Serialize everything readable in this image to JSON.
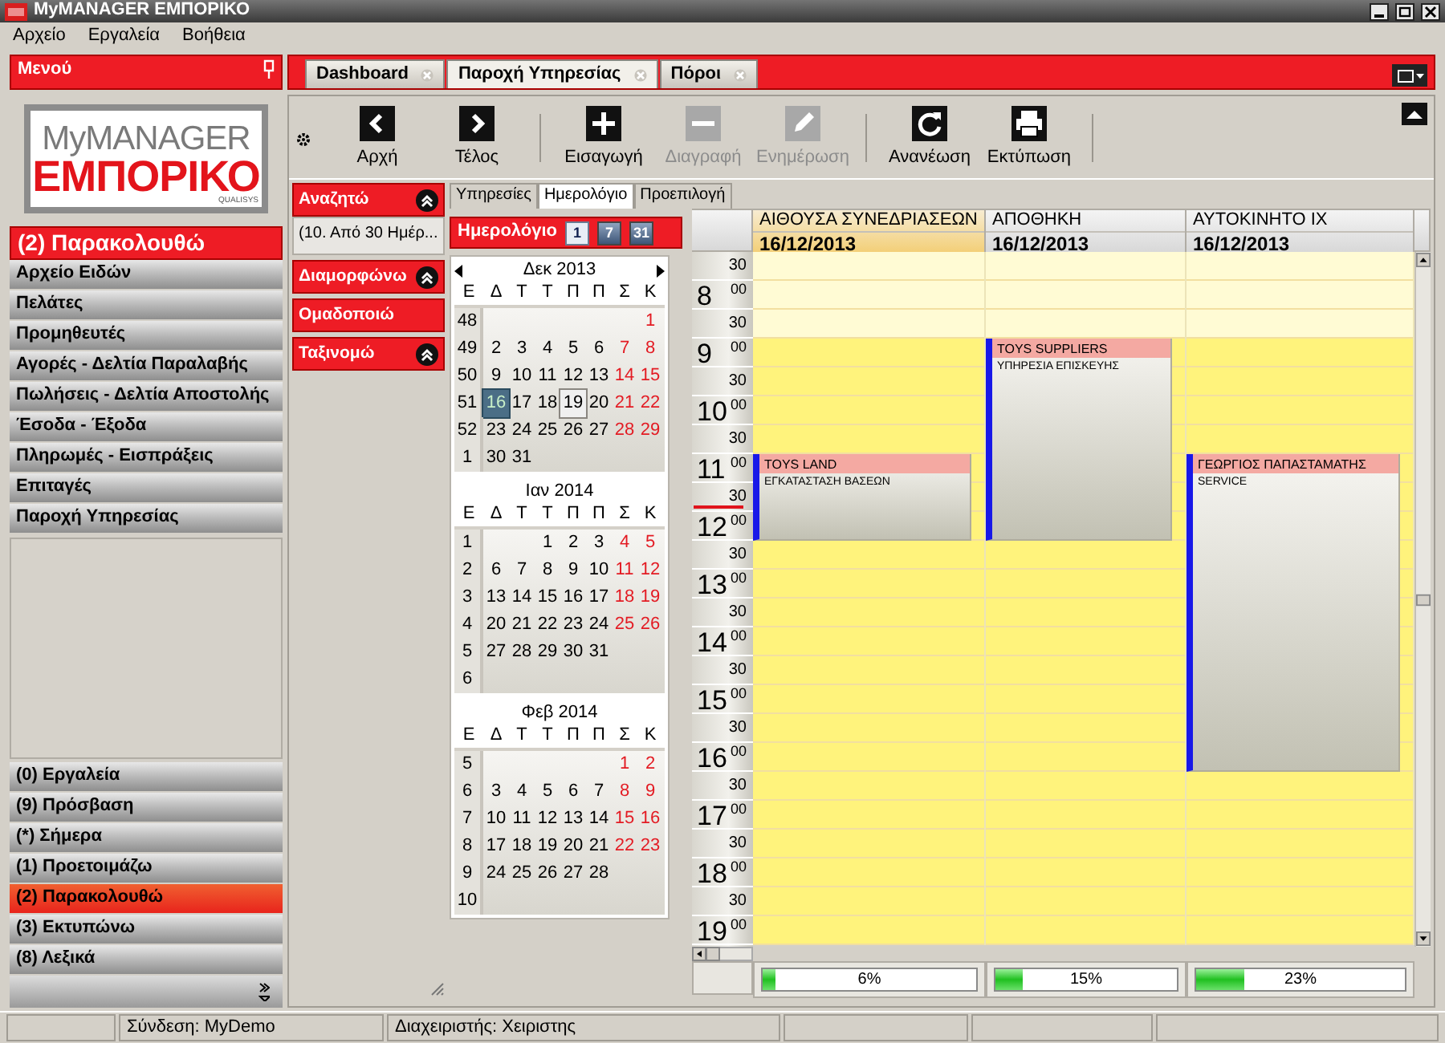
{
  "window": {
    "title": "MyMANAGER ΕΜΠΟΡΙΚΟ"
  },
  "menu_bar": [
    "Αρχείο",
    "Εργαλεία",
    "Βοήθεια"
  ],
  "sidebar": {
    "title": "Μενού",
    "logo": {
      "line1": "MyMANAGER",
      "line2": "ΕΜΠΟΡΙΚΟ",
      "line3": "QUALISYS"
    },
    "section": "(2) Παρακολουθώ",
    "items": [
      "Αρχείο Ειδών",
      "Πελάτες",
      "Προμηθευτές",
      "Αγορές - Δελτία Παραλαβής",
      "Πωλήσεις - Δελτία Αποστολής",
      "Έσοδα - Έξοδα",
      "Πληρωμές - Εισπράξεις",
      "Επιταγές",
      "Παροχή Υπηρεσίας"
    ],
    "groups": [
      {
        "label": "(0) Εργαλεία",
        "selected": false
      },
      {
        "label": "(9) Πρόσβαση",
        "selected": false
      },
      {
        "label": "(*) Σήμερα",
        "selected": false
      },
      {
        "label": "(1) Προετοιμάζω",
        "selected": false
      },
      {
        "label": "(2) Παρακολουθώ",
        "selected": true
      },
      {
        "label": "(3) Εκτυπώνω",
        "selected": false
      },
      {
        "label": "(8) Λεξικά",
        "selected": false
      }
    ]
  },
  "tabs": [
    {
      "label": "Dashboard",
      "selected": false
    },
    {
      "label": "Παροχή Υπηρεσίας",
      "selected": true
    },
    {
      "label": "Πόροι",
      "selected": false
    }
  ],
  "toolbar": [
    {
      "kind": "first",
      "label": "Αρχή",
      "disabled": false
    },
    {
      "kind": "last",
      "label": "Τέλος",
      "disabled": false
    },
    {
      "kind": "insert",
      "label": "Εισαγωγή",
      "disabled": false
    },
    {
      "kind": "delete",
      "label": "Διαγραφή",
      "disabled": true
    },
    {
      "kind": "edit",
      "label": "Ενημέρωση",
      "disabled": true
    },
    {
      "kind": "refresh",
      "label": "Ανανέωση",
      "disabled": false
    },
    {
      "kind": "print",
      "label": "Εκτύπωση",
      "disabled": false
    }
  ],
  "filters": [
    {
      "label": "Αναζητώ",
      "collapsible": true,
      "value": "(10. Από 30 Ημέρ..."
    },
    {
      "label": "Διαμορφώνω",
      "collapsible": true
    },
    {
      "label": "Ομαδοποιώ",
      "collapsible": false
    },
    {
      "label": "Ταξινομώ",
      "collapsible": true
    }
  ],
  "view_tabs": [
    {
      "label": "Υπηρεσίες",
      "selected": false
    },
    {
      "label": "Ημερολόγιο",
      "selected": true
    },
    {
      "label": "Προεπιλογή",
      "selected": false
    }
  ],
  "calendar": {
    "title": "Ημερολόγιο",
    "views": [
      {
        "label": "1",
        "selected": true
      },
      {
        "label": "7",
        "selected": false
      },
      {
        "label": "31",
        "selected": false
      }
    ],
    "months": [
      {
        "title": "Δεκ 2013",
        "arrows": true,
        "weekdays": [
          "Ε",
          "Δ",
          "Τ",
          "Τ",
          "Π",
          "Π",
          "Σ",
          "Κ"
        ],
        "weeks": [
          {
            "week": "48",
            "align_end": true,
            "days": [
              "1"
            ]
          },
          {
            "week": "49",
            "days": [
              "2",
              "3",
              "4",
              "5",
              "6",
              "7",
              "8"
            ]
          },
          {
            "week": "50",
            "days": [
              "9",
              "10",
              "11",
              "12",
              "13",
              "14",
              "15"
            ]
          },
          {
            "week": "51",
            "days": [
              {
                "t": "16",
                "selected": true,
                "today": false
              },
              "17",
              "18",
              {
                "t": "19",
                "selected": false,
                "today": true
              },
              "20",
              "21",
              "22"
            ]
          },
          {
            "week": "52",
            "days": [
              "23",
              "24",
              "25",
              "26",
              "27",
              "28",
              "29"
            ]
          },
          {
            "week": "1",
            "days": [
              "30",
              "31"
            ]
          }
        ]
      },
      {
        "title": "Ιαν 2014",
        "arrows": false,
        "weekdays": [
          "Ε",
          "Δ",
          "Τ",
          "Τ",
          "Π",
          "Π",
          "Σ",
          "Κ"
        ],
        "weeks": [
          {
            "week": "1",
            "align_end": true,
            "days": [
              "1",
              "2",
              "3",
              "4",
              "5"
            ]
          },
          {
            "week": "2",
            "days": [
              "6",
              "7",
              "8",
              "9",
              "10",
              "11",
              "12"
            ]
          },
          {
            "week": "3",
            "days": [
              "13",
              "14",
              "15",
              "16",
              "17",
              "18",
              "19"
            ]
          },
          {
            "week": "4",
            "days": [
              "20",
              "21",
              "22",
              "23",
              "24",
              "25",
              "26"
            ]
          },
          {
            "week": "5",
            "days": [
              "27",
              "28",
              "29",
              "30",
              "31"
            ]
          },
          {
            "week": "6"
          }
        ]
      },
      {
        "title": "Φεβ 2014",
        "arrows": false,
        "weekdays": [
          "Ε",
          "Δ",
          "Τ",
          "Τ",
          "Π",
          "Π",
          "Σ",
          "Κ"
        ],
        "weeks": [
          {
            "week": "5",
            "align_end": true,
            "days": [
              "1",
              "2"
            ]
          },
          {
            "week": "6",
            "days": [
              "3",
              "4",
              "5",
              "6",
              "7",
              "8",
              "9"
            ]
          },
          {
            "week": "7",
            "days": [
              "10",
              "11",
              "12",
              "13",
              "14",
              "15",
              "16"
            ]
          },
          {
            "week": "8",
            "days": [
              "17",
              "18",
              "19",
              "20",
              "21",
              "22",
              "23"
            ]
          },
          {
            "week": "9",
            "days": [
              "24",
              "25",
              "26",
              "27",
              "28"
            ]
          },
          {
            "week": "10"
          }
        ]
      }
    ]
  },
  "scheduler": {
    "slots": [
      {
        "min": "30",
        "working": false,
        "current": false
      },
      {
        "hour": "8",
        "min": "00",
        "working": false,
        "current": false
      },
      {
        "min": "30",
        "working": false,
        "current": false
      },
      {
        "hour": "9",
        "min": "00",
        "working": true,
        "current": false
      },
      {
        "min": "30",
        "working": true,
        "current": false
      },
      {
        "hour": "10",
        "min": "00",
        "working": true,
        "current": false
      },
      {
        "min": "30",
        "working": true,
        "current": false
      },
      {
        "hour": "11",
        "min": "00",
        "working": true,
        "current": false
      },
      {
        "min": "30",
        "working": true,
        "current": true
      },
      {
        "hour": "12",
        "min": "00",
        "working": true,
        "current": false
      },
      {
        "min": "30",
        "working": true,
        "current": false
      },
      {
        "hour": "13",
        "min": "00",
        "working": true,
        "current": false
      },
      {
        "min": "30",
        "working": true,
        "current": false
      },
      {
        "hour": "14",
        "min": "00",
        "working": true,
        "current": false
      },
      {
        "min": "30",
        "working": true,
        "current": false
      },
      {
        "hour": "15",
        "min": "00",
        "working": true,
        "current": false
      },
      {
        "min": "30",
        "working": true,
        "current": false
      },
      {
        "hour": "16",
        "min": "00",
        "working": true,
        "current": false
      },
      {
        "min": "30",
        "working": true,
        "current": false
      },
      {
        "hour": "17",
        "min": "00",
        "working": true,
        "current": false
      },
      {
        "min": "30",
        "working": true,
        "current": false
      },
      {
        "hour": "18",
        "min": "00",
        "working": true,
        "current": false
      },
      {
        "min": "30",
        "working": true,
        "current": false
      },
      {
        "hour": "19",
        "min": "00",
        "working": true,
        "current": false
      }
    ],
    "resources": [
      {
        "name": "ΑΙΘΟΥΣΑ ΣΥΝΕΔΡΙΑΣΕΩΝ",
        "date": "16/12/2013",
        "selected": true,
        "usage": {
          "level": 0.06,
          "text": "6%"
        },
        "busy": [
          false,
          false,
          false,
          false,
          false,
          false,
          false,
          true,
          true,
          true,
          false,
          false,
          false,
          false,
          false,
          false,
          false,
          false,
          false,
          false,
          false,
          false,
          false,
          false
        ],
        "events": [
          {
            "title": "TOYS LAND",
            "subtitle": "ΕΓΚΑΤΑΣΤΑΣΗ ΒΑΣΕΩΝ"
          }
        ]
      },
      {
        "name": "ΑΠΟΘΗΚΗ",
        "date": "16/12/2013",
        "selected": false,
        "usage": {
          "level": 0.15,
          "text": "15%"
        },
        "busy": [
          false,
          false,
          false,
          true,
          true,
          true,
          true,
          true,
          true,
          true,
          false,
          false,
          false,
          false,
          false,
          false,
          false,
          false,
          false,
          false,
          false,
          false,
          false,
          false
        ],
        "events": [
          {
            "title": "TOYS SUPPLIERS",
            "subtitle": "ΥΠΗΡΕΣΙΑ ΕΠΙΣΚΕΥΗΣ"
          }
        ]
      },
      {
        "name": "ΑΥΤΟΚΙΝΗΤΟ ΙΧ",
        "date": "16/12/2013",
        "selected": false,
        "usage": {
          "level": 0.23,
          "text": "23%"
        },
        "busy": [
          false,
          false,
          false,
          false,
          false,
          false,
          false,
          true,
          true,
          true,
          true,
          true,
          true,
          true,
          true,
          true,
          true,
          true,
          false,
          false,
          false,
          false,
          false,
          false
        ],
        "events": [
          {
            "title": "ΓΕΩΡΓΙΟΣ ΠΑΠΑΣΤΑΜΑΤΗΣ",
            "subtitle": "SERVICE"
          }
        ]
      }
    ]
  },
  "status_bar": {
    "login": "Σύνδεση: MyDemo",
    "operator": "Διαχειριστής: Χειριστης"
  }
}
